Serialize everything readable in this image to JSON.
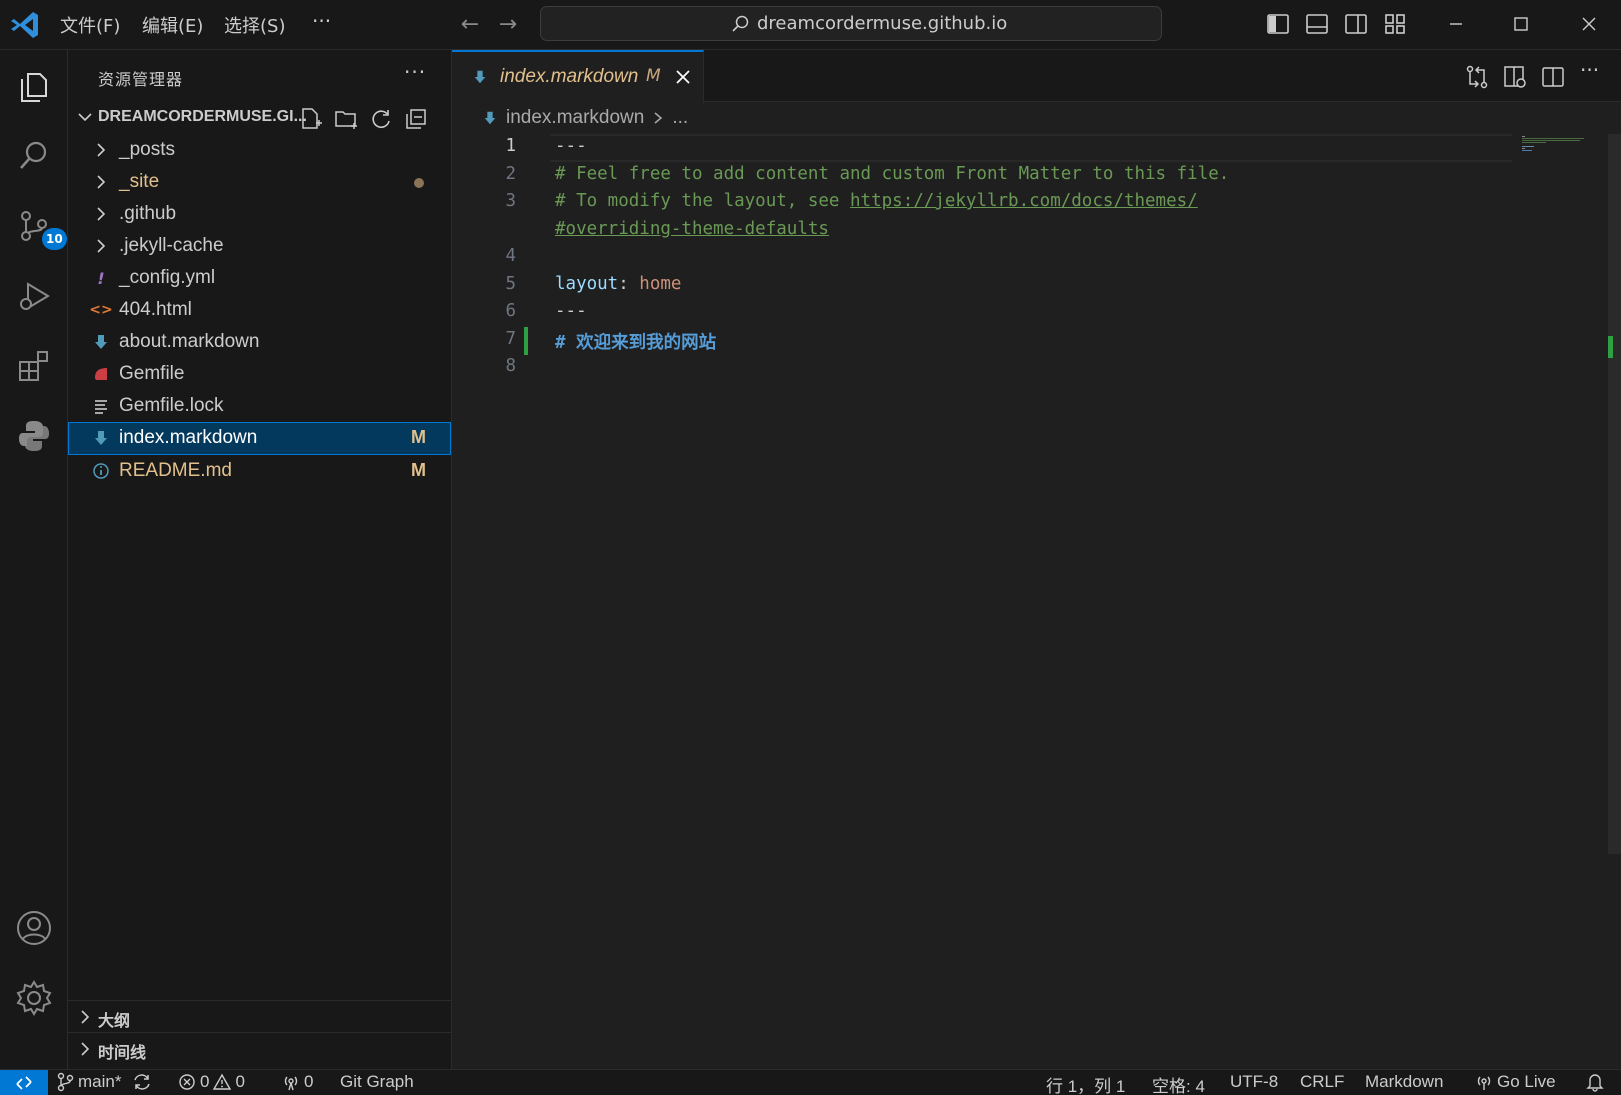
{
  "titlebar": {
    "menus": [
      "文件(F)",
      "编辑(E)",
      "选择(S)"
    ],
    "more": "···",
    "search_text": "dreamcordermuse.github.io"
  },
  "activitybar": {
    "scm_badge": "10"
  },
  "sidebar": {
    "title": "资源管理器",
    "more": "···",
    "folder_name": "DREAMCORDERMUSE.GI...",
    "items": [
      {
        "label": "_posts",
        "type": "folder",
        "color": "#cccccc"
      },
      {
        "label": "_site",
        "type": "folder",
        "color": "#e2c08d"
      },
      {
        "label": ".github",
        "type": "folder",
        "color": "#cccccc"
      },
      {
        "label": ".jekyll-cache",
        "type": "folder",
        "color": "#cccccc"
      },
      {
        "label": "_config.yml",
        "type": "yaml",
        "color": "#cccccc"
      },
      {
        "label": "404.html",
        "type": "html",
        "color": "#cccccc"
      },
      {
        "label": "about.markdown",
        "type": "markdown",
        "color": "#cccccc"
      },
      {
        "label": "Gemfile",
        "type": "ruby",
        "color": "#cccccc"
      },
      {
        "label": "Gemfile.lock",
        "type": "lock",
        "color": "#cccccc"
      },
      {
        "label": "index.markdown",
        "type": "markdown",
        "color": "#ffffff",
        "decoration": "M",
        "selected": true
      },
      {
        "label": "README.md",
        "type": "info",
        "color": "#e2c08d",
        "decoration": "M"
      }
    ],
    "outline_label": "大纲",
    "timeline_label": "时间线"
  },
  "editor": {
    "tab_label": "index.markdown",
    "tab_modified": "M",
    "breadcrumb_file": "index.markdown",
    "breadcrumb_more": "...",
    "lines": [
      {
        "n": "1",
        "active": true
      },
      {
        "n": "2"
      },
      {
        "n": "3"
      },
      {
        "n": ""
      },
      {
        "n": "4"
      },
      {
        "n": "5"
      },
      {
        "n": "6"
      },
      {
        "n": "7"
      },
      {
        "n": "8"
      }
    ],
    "code": {
      "l1": "---",
      "l2": "# Feel free to add content and custom Front Matter to this file.",
      "l3a": "# To modify the layout, see ",
      "l3b": "https://jekyllrb.com/docs/themes/",
      "l3c": "#overriding-theme-defaults",
      "l5_key": "layout",
      "l5_colon": ": ",
      "l5_val": "home",
      "l6": "---",
      "l7": "# 欢迎来到我的网站"
    }
  },
  "statusbar": {
    "branch": "main*",
    "errors": "0",
    "warnings": "0",
    "ports": "0",
    "git_graph": "Git Graph",
    "position": "行 1，列 1",
    "indent": "空格: 4",
    "encoding": "UTF-8",
    "eol": "CRLF",
    "language": "Markdown",
    "golive": "Go Live"
  },
  "colors": {
    "accent": "#0078d4",
    "modified": "#e2c08d",
    "comment": "#6a9955",
    "added": "#2ea043"
  }
}
